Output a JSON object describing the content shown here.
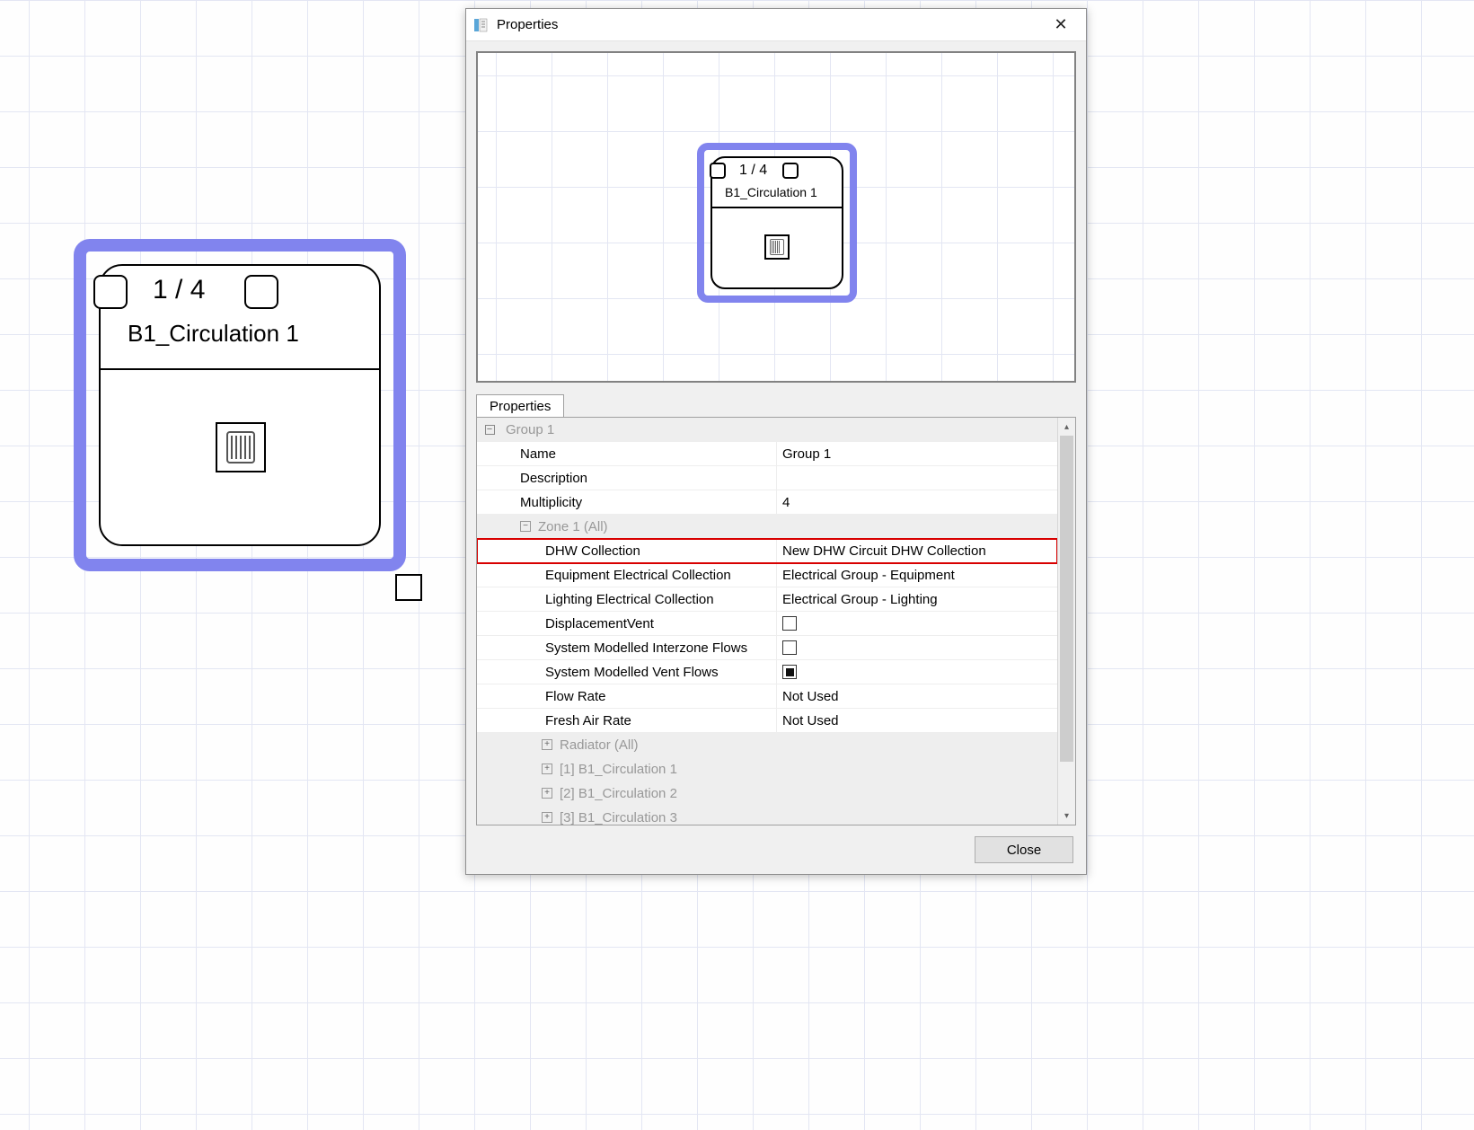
{
  "canvas": {
    "node": {
      "count_label": "1 / 4",
      "name": "B1_Circulation 1"
    }
  },
  "dialog": {
    "title": "Properties",
    "tab_label": "Properties",
    "close_label": "Close",
    "preview_node": {
      "count_label": "1 / 4",
      "name": "B1_Circulation 1"
    },
    "grid": {
      "root_header": "Group 1",
      "rows": [
        {
          "label": "Name",
          "value": "Group 1",
          "indent": 1
        },
        {
          "label": "Description",
          "value": "",
          "indent": 1
        },
        {
          "label": "Multiplicity",
          "value": "4",
          "indent": 1
        }
      ],
      "zone_header": "Zone 1 (All)",
      "zone_rows": [
        {
          "label": "DHW Collection",
          "value": "New DHW Circuit DHW Collection",
          "highlight": true
        },
        {
          "label": "Equipment Electrical Collection",
          "value": "Electrical Group - Equipment"
        },
        {
          "label": "Lighting Electrical Collection",
          "value": "Electrical Group - Lighting"
        },
        {
          "label": "DisplacementVent",
          "checkbox": "empty"
        },
        {
          "label": "System Modelled Interzone Flows",
          "checkbox": "empty"
        },
        {
          "label": "System Modelled Vent Flows",
          "checkbox": "filled"
        },
        {
          "label": "Flow Rate",
          "value": "Not Used"
        },
        {
          "label": "Fresh Air Rate",
          "value": "Not Used"
        }
      ],
      "children": [
        "Radiator (All)",
        "[1] B1_Circulation 1",
        "[2] B1_Circulation 2",
        "[3] B1_Circulation 3"
      ]
    }
  }
}
